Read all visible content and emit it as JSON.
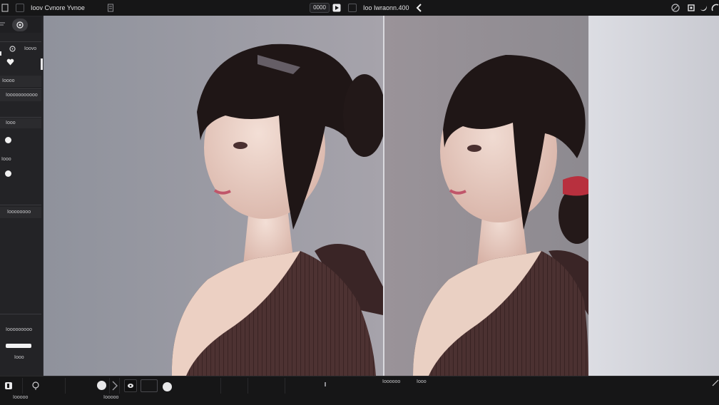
{
  "app": {
    "title": "Ioov Cvnore Yvnoe",
    "zoom_label": "0000",
    "doc_label": "Ioo Iwraonn.400"
  },
  "left_panel": {
    "row1_value": "Ioovo",
    "label_a": "Ioooo",
    "label_b": "Iooooooooooo",
    "label_c": "Iooo",
    "label_d": "Iooo",
    "label_e": "Ioooooooo",
    "label_f": "Iooooooooo",
    "label_g": "Iooo"
  },
  "bottom_bar": {
    "status_a": "Ioooooo",
    "status_b": "Iooo",
    "status_c": "Iooooo",
    "status_d": "Iooooo"
  },
  "colors": {
    "accent": "#e8e8ea",
    "panel": "#232326",
    "canvas_bg": "#c9c9cf"
  },
  "icons": [
    "close-icon",
    "menu-icon",
    "play-icon",
    "back-arrow-icon",
    "circle-icon",
    "square-icon",
    "moon-icon",
    "half-icon",
    "heart-icon",
    "gear-icon",
    "eye-icon",
    "pin-icon"
  ]
}
